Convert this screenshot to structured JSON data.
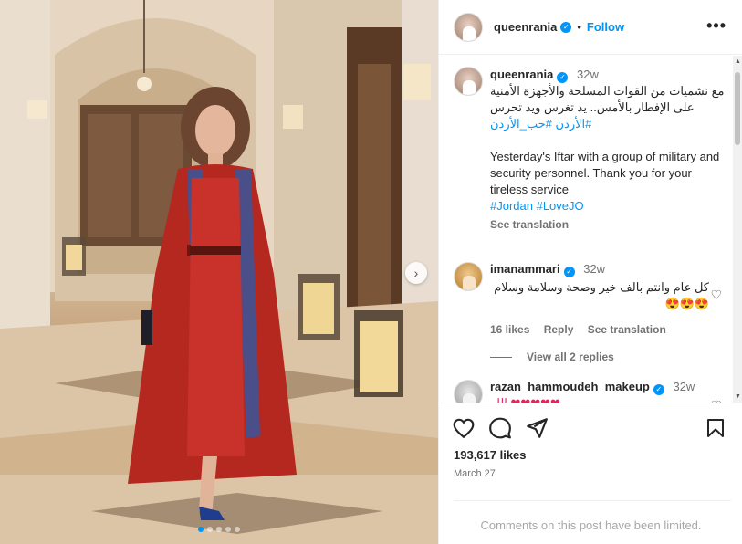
{
  "post": {
    "username": "queenrania",
    "follow_label": "Follow",
    "more_label": "•••",
    "caption": {
      "time": "32w",
      "arabic_text": "مع نشميات من القوات المسلحة والأجهزة الأمنية على الإفطار بالأمس.. يد تغرس ويد تحرس",
      "arabic_tags": "#الأردن #حب_الأردن",
      "english_text": "Yesterday's Iftar with a group of military and security personnel. Thank you for your tireless service",
      "english_tags": "#Jordan #LoveJO",
      "see_translation": "See translation"
    },
    "comments": [
      {
        "username": "imanammari",
        "time": "32w",
        "text": "كل عام وانتم بالف خير وصحة وسلامة وسلام 😍😍😍",
        "likes": "16 likes",
        "reply": "Reply",
        "see_translation": "See translation",
        "view_replies": "View all 2 replies"
      },
      {
        "username": "razan_hammoudeh_makeup",
        "time": "32w",
        "text": "❤❤❤❤❤ الله"
      }
    ],
    "likes": "193,617 likes",
    "date": "March 27",
    "comments_limited": "Comments on this post have been limited.",
    "carousel": {
      "total": 5,
      "active": 0
    },
    "icons": {
      "verified": "verified-badge",
      "like": "heart-icon",
      "comment": "comment-icon",
      "share": "share-icon",
      "save": "bookmark-icon",
      "next": "chevron-right-icon"
    }
  }
}
